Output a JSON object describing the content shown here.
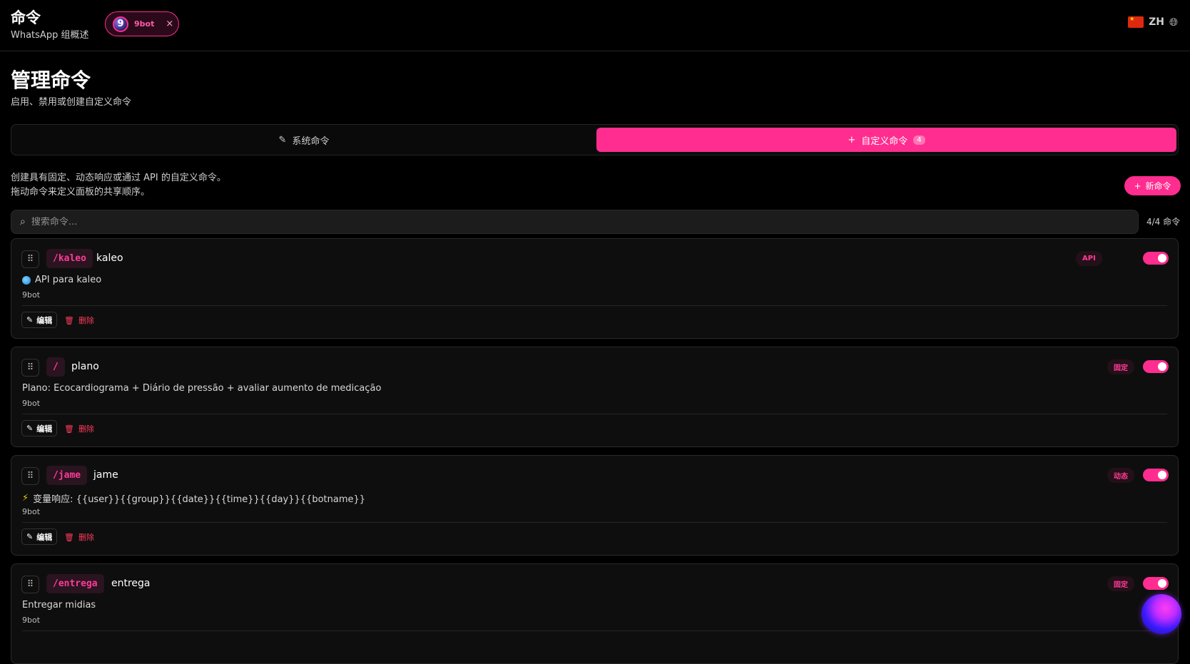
{
  "header": {
    "title": "命令",
    "subtitle": "WhatsApp 组概述",
    "bot_chip": {
      "avatar_letter": "9",
      "name": "9bot",
      "close": "×"
    },
    "language": {
      "code": "ZH"
    }
  },
  "page": {
    "title": "管理命令",
    "subtitle": "启用、禁用或创建自定义命令"
  },
  "tabs": [
    {
      "label": "系统命令",
      "icon": "pen-icon"
    },
    {
      "label": "自定义命令",
      "icon": "plus-icon",
      "count": "4",
      "active": true
    }
  ],
  "intro": {
    "line1": "创建具有固定、动态响应或通过 API 的自定义命令。",
    "line2": "拖动命令来定义面板的共享顺序。"
  },
  "new_button": {
    "label": "新命令"
  },
  "search": {
    "placeholder": "搜索命令...",
    "value": ""
  },
  "count_label": "4/4 命令",
  "actions": {
    "edit": "编辑",
    "delete": "删除"
  },
  "commands": [
    {
      "tag": "/kaleo",
      "name": "kaleo",
      "desc": "API para kaleo",
      "desc_icon": "globe-icon",
      "owner": "9bot",
      "type": "API",
      "enabled": true
    },
    {
      "tag": "/",
      "name": "plano",
      "desc": "Plano: Ecocardiograma + Diário de pressão + avaliar aumento de medicação",
      "desc_icon": "",
      "owner": "9bot",
      "type": "固定",
      "enabled": true
    },
    {
      "tag": "/jame",
      "name": "jame",
      "desc": "变量响应: {{user}}{{group}}{{date}}{{time}}{{day}}{{botname}}",
      "desc_icon": "bolt-icon",
      "owner": "9bot",
      "type": "动态",
      "enabled": true
    },
    {
      "tag": "/entrega",
      "name": "entrega",
      "desc": "Entregar midias",
      "desc_icon": "",
      "owner": "9bot",
      "type": "固定",
      "enabled": true
    }
  ],
  "colors": {
    "accent": "#ff2d8f",
    "background": "#000000",
    "danger": "#ff3b5c"
  }
}
